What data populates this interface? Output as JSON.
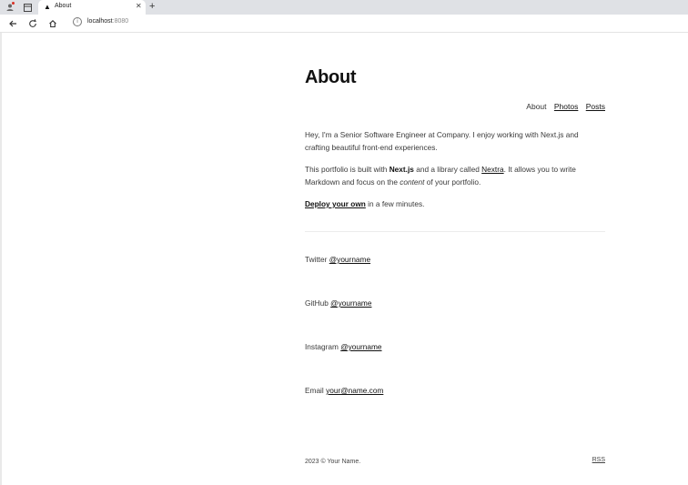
{
  "browser": {
    "tab_title": "About",
    "tab_favicon": "vercel-triangle-icon",
    "tab_close_glyph": "✕",
    "new_tab_glyph": "+",
    "url_host": "localhost",
    "url_port": ":8080"
  },
  "page": {
    "heading": "About",
    "nav": {
      "about": "About",
      "photos": "Photos",
      "posts": "Posts"
    },
    "intro": "Hey, I'm a Senior Software Engineer at Company. I enjoy working with Next.js and crafting beautiful front-end experiences.",
    "built_prefix": "This portfolio is built with ",
    "built_nextjs": "Next.js",
    "built_mid": " and a library called ",
    "built_nextra": "Nextra",
    "built_mid2": ". It allows you to write Markdown and focus on the ",
    "built_content": "content",
    "built_suffix": " of your portfolio.",
    "deploy_link": "Deploy your own",
    "deploy_suffix": " in a few minutes.",
    "socials": [
      {
        "label": "Twitter",
        "handle": "@yourname"
      },
      {
        "label": "GitHub",
        "handle": "@yourname"
      },
      {
        "label": "Instagram",
        "handle": "@yourname"
      },
      {
        "label": "Email",
        "handle": "your@name.com"
      }
    ],
    "footer": "2023 © Your Name.",
    "rss": "RSS"
  }
}
